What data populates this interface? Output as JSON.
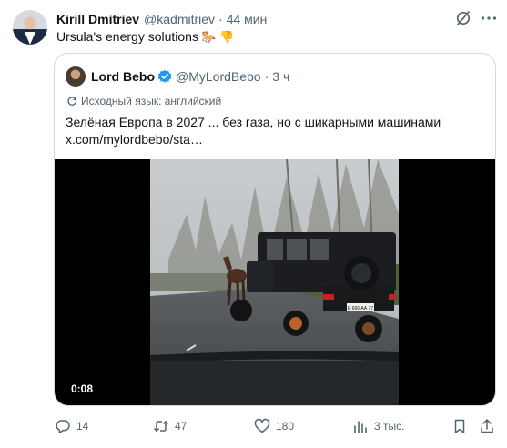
{
  "post": {
    "author_name": "Kirill Dmitriev",
    "author_handle": "@kadmitriev",
    "separator": "·",
    "time": "44 мин",
    "text": "Ursula's energy solutions",
    "emojis": "🐎 👎"
  },
  "quoted": {
    "author_name": "Lord Bebo",
    "author_handle": "@MyLordBebo",
    "separator": "·",
    "time": "3 ч",
    "translate_note": "Исходный язык: английский",
    "text_line1": "Зелёная Европа в 2027 ... без газа, но с шикарными машинами",
    "text_line2": "x.com/mylordbebo/sta…",
    "video": {
      "duration": "0:08",
      "plate": "Е 666 АА 77"
    }
  },
  "actions": {
    "replies": "14",
    "reposts": "47",
    "likes": "180",
    "views": "3 тыс."
  },
  "colors": {
    "text": "#0f1419",
    "secondary": "#536471",
    "border": "#cfd9de",
    "verified": "#1d9bf0"
  },
  "icons": [
    "grok-icon",
    "more-icon",
    "verified-icon",
    "translate-icon",
    "reply-icon",
    "repost-icon",
    "like-icon",
    "views-icon",
    "bookmark-icon",
    "share-icon"
  ]
}
